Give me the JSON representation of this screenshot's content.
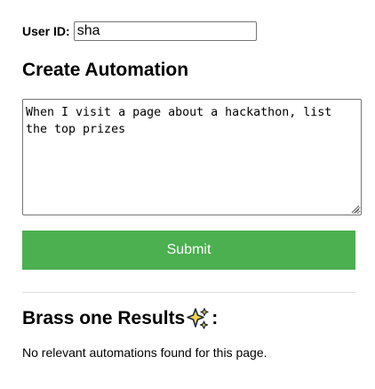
{
  "user": {
    "label": "User ID:",
    "value": "sha"
  },
  "create": {
    "title": "Create Automation",
    "prompt_value": "When I visit a page about a hackathon, list the top prizes",
    "submit_label": "Submit"
  },
  "results": {
    "title": "Brass one Results",
    "title_suffix": ":",
    "icon": "sparkles-icon",
    "empty_message": "No relevant automations found for this page."
  },
  "colors": {
    "submit_background": "#4caf50",
    "submit_text": "#ffffff",
    "divider": "#dddddd",
    "sparkle_fill": "#f5d547",
    "sparkle_outline": "#1f2a44"
  }
}
